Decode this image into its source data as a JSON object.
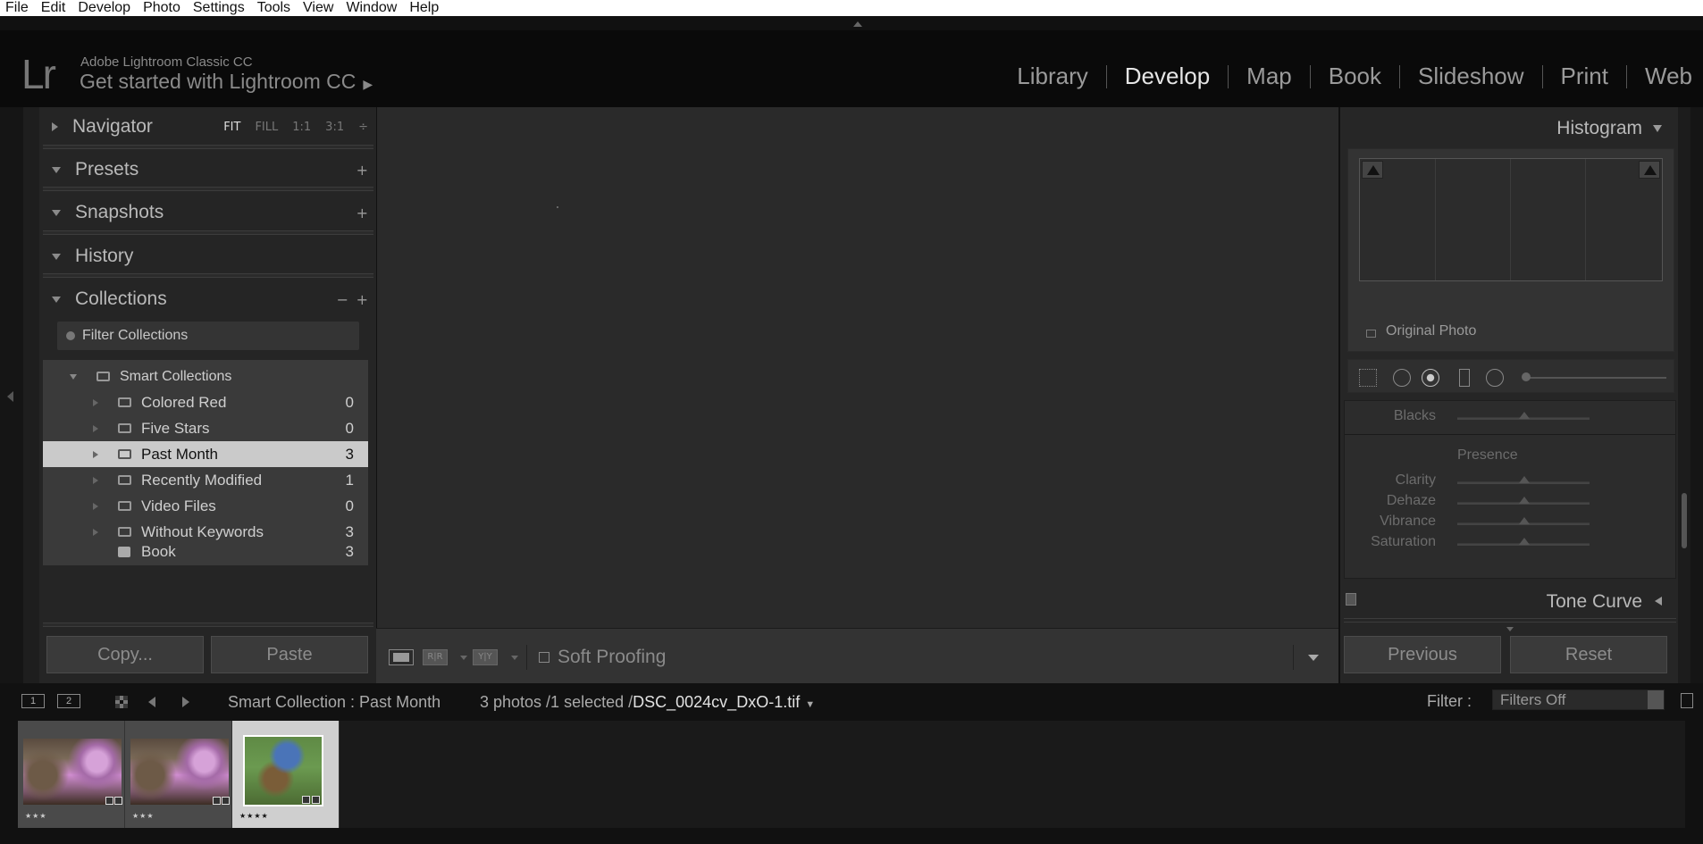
{
  "menu": [
    "File",
    "Edit",
    "Develop",
    "Photo",
    "Settings",
    "Tools",
    "View",
    "Window",
    "Help"
  ],
  "identity": {
    "logo": "Lr",
    "product": "Adobe Lightroom Classic CC",
    "get_started": "Get started with Lightroom CC",
    "get_started_arrow": "▶"
  },
  "modules": [
    "Library",
    "Develop",
    "Map",
    "Book",
    "Slideshow",
    "Print",
    "Web"
  ],
  "active_module": "Develop",
  "left_panel": {
    "navigator": {
      "title": "Navigator",
      "options": [
        "FIT",
        "FILL",
        "1:1",
        "3:1"
      ],
      "active_option": "FIT",
      "more": "÷"
    },
    "presets": {
      "title": "Presets",
      "add": "+"
    },
    "snapshots": {
      "title": "Snapshots",
      "add": "+"
    },
    "history": {
      "title": "History"
    },
    "collections": {
      "title": "Collections",
      "remove": "−",
      "add": "+",
      "filter_placeholder": "Filter Collections",
      "parent": "Smart Collections",
      "items": [
        {
          "name": "Colored Red",
          "count": "0"
        },
        {
          "name": "Five Stars",
          "count": "0"
        },
        {
          "name": "Past Month",
          "count": "3",
          "selected": true
        },
        {
          "name": "Recently Modified",
          "count": "1"
        },
        {
          "name": "Video Files",
          "count": "0"
        },
        {
          "name": "Without Keywords",
          "count": "3"
        },
        {
          "name": "Book",
          "count": "3"
        }
      ]
    },
    "copy_button": "Copy...",
    "paste_button": "Paste"
  },
  "toolbar": {
    "view_before_after": "R|R",
    "view_side": "Y|Y",
    "soft_proofing": "Soft Proofing"
  },
  "right_panel": {
    "histogram": {
      "title": "Histogram",
      "original_photo": "Original Photo"
    },
    "basic": {
      "blacks": "Blacks",
      "presence": "Presence",
      "clarity": "Clarity",
      "dehaze": "Dehaze",
      "vibrance": "Vibrance",
      "saturation": "Saturation"
    },
    "tone_curve": "Tone Curve",
    "previous_button": "Previous",
    "reset_button": "Reset"
  },
  "filmstrip_bar": {
    "screen1": "1",
    "screen2": "2",
    "source": "Smart Collection : Past Month",
    "count": "3 photos /1 selected /",
    "file": "DSC_0024cv_DxO-1.tif",
    "filter_label": "Filter :",
    "filter_value": "Filters Off"
  },
  "filmstrip": [
    {
      "stars": "★★★",
      "rating": 3
    },
    {
      "stars": "★★★",
      "rating": 3
    },
    {
      "stars": "★★★★",
      "rating": 4,
      "selected": true
    }
  ]
}
